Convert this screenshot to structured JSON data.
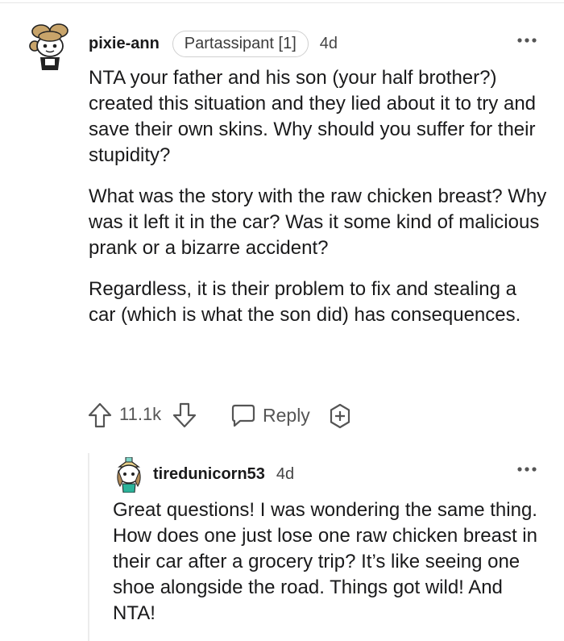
{
  "comment": {
    "username": "pixie-ann",
    "flair": "Partassipant [1]",
    "age": "4d",
    "avatar_icon": "snoo-avatar-icon",
    "paragraphs": [
      "NTA your father and his son (your half brother?) created this situation and they lied about it to try and save their own skins. Why should you suffer for their stupidity?",
      "What was the story with the raw chicken breast? Why was it left it in the car? Was it some kind of malicious prank or a bizarre accident?",
      "Regardless, it is their problem to fix and stealing a car (which is what the son did) has consequences."
    ],
    "votes": "11.1k",
    "reply_label": "Reply"
  },
  "reply": {
    "username": "tiredunicorn53",
    "age": "4d",
    "avatar_icon": "snoo-avatar-icon",
    "text": "Great questions! I was wondering the same thing. How does one just lose one raw chicken breast in their car after a grocery trip? It’s like seeing one shoe alongside the road. Things got wild! And NTA!"
  },
  "icons": [
    "more-options-icon",
    "upvote-icon",
    "downvote-icon",
    "reply-bubble-icon",
    "award-icon"
  ],
  "colors": {
    "text": "#1a1a1b",
    "meta": "#555555",
    "flair_border": "#d0d0d0",
    "thread_line": "#ececec"
  }
}
